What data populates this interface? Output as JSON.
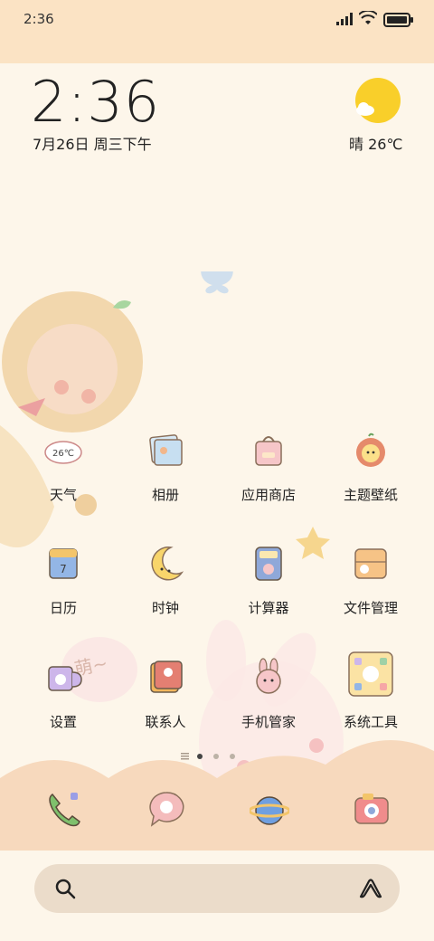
{
  "status_bar": {
    "time": "2:36"
  },
  "clock_widget": {
    "time": "2:36",
    "date": "7月26日 周三下午"
  },
  "weather_widget": {
    "condition_temp": "晴 26℃",
    "icon": "sunny-cloud-icon"
  },
  "apps": [
    {
      "label": "天气",
      "icon": "weather-icon",
      "badge": "26℃"
    },
    {
      "label": "相册",
      "icon": "gallery-icon"
    },
    {
      "label": "应用商店",
      "icon": "app-store-icon"
    },
    {
      "label": "主题壁纸",
      "icon": "themes-icon"
    },
    {
      "label": "日历",
      "icon": "calendar-icon",
      "badge": "7"
    },
    {
      "label": "时钟",
      "icon": "clock-icon"
    },
    {
      "label": "计算器",
      "icon": "calculator-icon"
    },
    {
      "label": "文件管理",
      "icon": "file-manager-icon"
    },
    {
      "label": "设置",
      "icon": "settings-icon"
    },
    {
      "label": "联系人",
      "icon": "contacts-icon"
    },
    {
      "label": "手机管家",
      "icon": "security-icon"
    },
    {
      "label": "系统工具",
      "icon": "system-tools-icon"
    }
  ],
  "wallpaper_text": "萌~",
  "pager": {
    "pages": 3,
    "current": 1
  },
  "dock": [
    {
      "icon": "phone-icon"
    },
    {
      "icon": "messages-icon"
    },
    {
      "icon": "browser-icon"
    },
    {
      "icon": "camera-icon"
    }
  ],
  "search": {
    "icon": "search-icon",
    "assistant_icon": "assistant-icon"
  },
  "colors": {
    "background": "#fdf6ea",
    "top_band": "#fbe3c4",
    "sun": "#f9cf2a",
    "dock_band": "#f7d9bd"
  }
}
